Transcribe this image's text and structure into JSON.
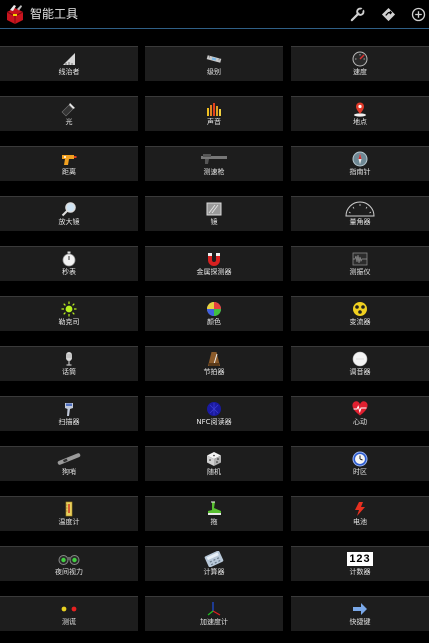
{
  "header": {
    "title": "智能工具",
    "accent_color": "#2f5f86",
    "icons": [
      "toolbox-icon",
      "wrench-icon",
      "compass-diamond-icon",
      "add-icon"
    ]
  },
  "tools": [
    {
      "label": "线治者",
      "icon": "ruler-icon"
    },
    {
      "label": "级别",
      "icon": "level-icon"
    },
    {
      "label": "速度",
      "icon": "speedometer-icon"
    },
    {
      "label": "光",
      "icon": "flashlight-icon"
    },
    {
      "label": "声音",
      "icon": "sound-meter-icon"
    },
    {
      "label": "地点",
      "icon": "location-pin-icon"
    },
    {
      "label": "距离",
      "icon": "distance-gun-icon"
    },
    {
      "label": "测速枪",
      "icon": "speed-gun-icon"
    },
    {
      "label": "指南针",
      "icon": "compass-icon"
    },
    {
      "label": "放大镜",
      "icon": "magnifier-icon"
    },
    {
      "label": "镜",
      "icon": "mirror-icon"
    },
    {
      "label": "量角器",
      "icon": "protractor-icon"
    },
    {
      "label": "秒表",
      "icon": "stopwatch-icon"
    },
    {
      "label": "金属探测器",
      "icon": "magnet-icon"
    },
    {
      "label": "测振仪",
      "icon": "vibration-icon"
    },
    {
      "label": "勒克司",
      "icon": "lux-icon"
    },
    {
      "label": "颜色",
      "icon": "color-icon"
    },
    {
      "label": "变流器",
      "icon": "converter-icon"
    },
    {
      "label": "话筒",
      "icon": "microphone-icon"
    },
    {
      "label": "节拍器",
      "icon": "metronome-icon"
    },
    {
      "label": "调音器",
      "icon": "tuner-icon"
    },
    {
      "label": "扫描器",
      "icon": "scanner-icon"
    },
    {
      "label": "NFC阅读器",
      "icon": "nfc-icon"
    },
    {
      "label": "心动",
      "icon": "heart-rate-icon"
    },
    {
      "label": "狗哨",
      "icon": "dog-whistle-icon"
    },
    {
      "label": "随机",
      "icon": "dice-icon"
    },
    {
      "label": "时区",
      "icon": "clock-icon"
    },
    {
      "label": "温度计",
      "icon": "thermometer-icon"
    },
    {
      "label": "拖",
      "icon": "tow-icon"
    },
    {
      "label": "电池",
      "icon": "battery-icon"
    },
    {
      "label": "夜间视力",
      "icon": "night-vision-icon"
    },
    {
      "label": "计算器",
      "icon": "calculator-icon"
    },
    {
      "label": "计数器",
      "icon": "counter-icon"
    },
    {
      "label": "测谎",
      "icon": "lie-detector-icon"
    },
    {
      "label": "加速度计",
      "icon": "accelerometer-icon"
    },
    {
      "label": "快捷键",
      "icon": "shortcut-arrow-icon"
    }
  ],
  "counter_digits": "123"
}
